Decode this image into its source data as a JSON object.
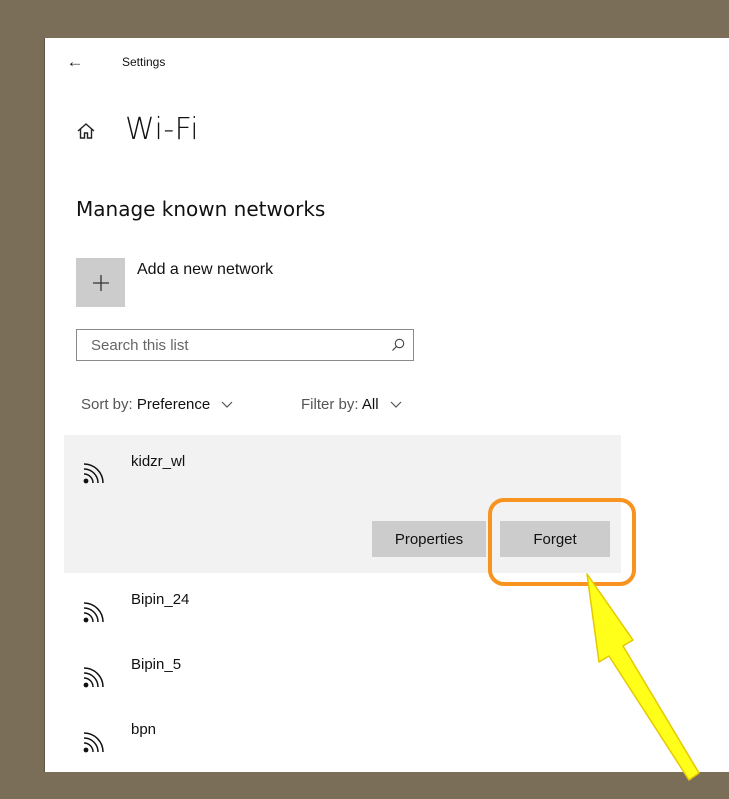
{
  "titlebar": {
    "app_title": "Settings",
    "back_icon": "back-arrow-icon"
  },
  "header": {
    "home_icon": "home-icon",
    "title": "Wi-Fi"
  },
  "section": {
    "title": "Manage known networks"
  },
  "add_network": {
    "label": "Add a new network",
    "icon": "plus-icon"
  },
  "search": {
    "placeholder": "Search this list",
    "value": ""
  },
  "sort": {
    "label": "Sort by:",
    "value": "Preference"
  },
  "filter": {
    "label": "Filter by:",
    "value": "All"
  },
  "networks": [
    {
      "name": "kidzr_wl",
      "selected": true
    },
    {
      "name": "Bipin_24"
    },
    {
      "name": "Bipin_5"
    },
    {
      "name": "bpn"
    }
  ],
  "actions": {
    "properties_label": "Properties",
    "forget_label": "Forget"
  },
  "annotation": {
    "highlight_color": "#f7931e",
    "arrow_color": "#ffff1a"
  }
}
